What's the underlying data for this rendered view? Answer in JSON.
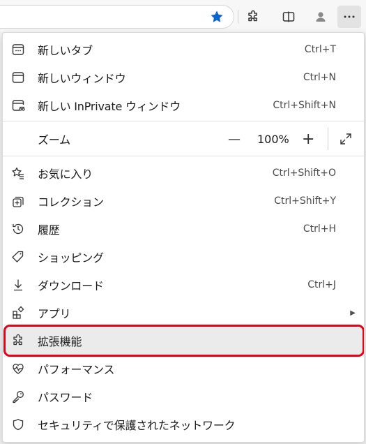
{
  "menu": {
    "new_tab": {
      "label": "新しいタブ",
      "shortcut": "Ctrl+T",
      "icon": "new-tab-icon"
    },
    "new_window": {
      "label": "新しいウィンドウ",
      "shortcut": "Ctrl+N",
      "icon": "window-icon"
    },
    "new_inprivate": {
      "label": "新しい InPrivate ウィンドウ",
      "shortcut": "Ctrl+Shift+N",
      "icon": "inprivate-icon"
    },
    "zoom": {
      "label": "ズーム",
      "minus": "—",
      "value": "100%",
      "plus": "+",
      "icon": "fullscreen-icon"
    },
    "favorites": {
      "label": "お気に入り",
      "shortcut": "Ctrl+Shift+O",
      "icon": "favorites-icon"
    },
    "collections": {
      "label": "コレクション",
      "shortcut": "Ctrl+Shift+Y",
      "icon": "collections-icon"
    },
    "history": {
      "label": "履歴",
      "shortcut": "Ctrl+H",
      "icon": "history-icon"
    },
    "shopping": {
      "label": "ショッピング",
      "shortcut": "",
      "icon": "shopping-tag-icon"
    },
    "downloads": {
      "label": "ダウンロード",
      "shortcut": "Ctrl+J",
      "icon": "download-icon"
    },
    "apps": {
      "label": "アプリ",
      "arrow": "▶",
      "icon": "apps-icon"
    },
    "extensions": {
      "label": "拡張機能",
      "icon": "puzzle-icon"
    },
    "performance": {
      "label": "パフォーマンス",
      "icon": "heartbeat-icon"
    },
    "passwords": {
      "label": "パスワード",
      "icon": "key-icon"
    },
    "secure_network": {
      "label": "セキュリティで保護されたネットワーク",
      "icon": "shield-icon"
    }
  },
  "colors": {
    "accent": "#0a64d0",
    "highlight_border": "#e60012"
  }
}
